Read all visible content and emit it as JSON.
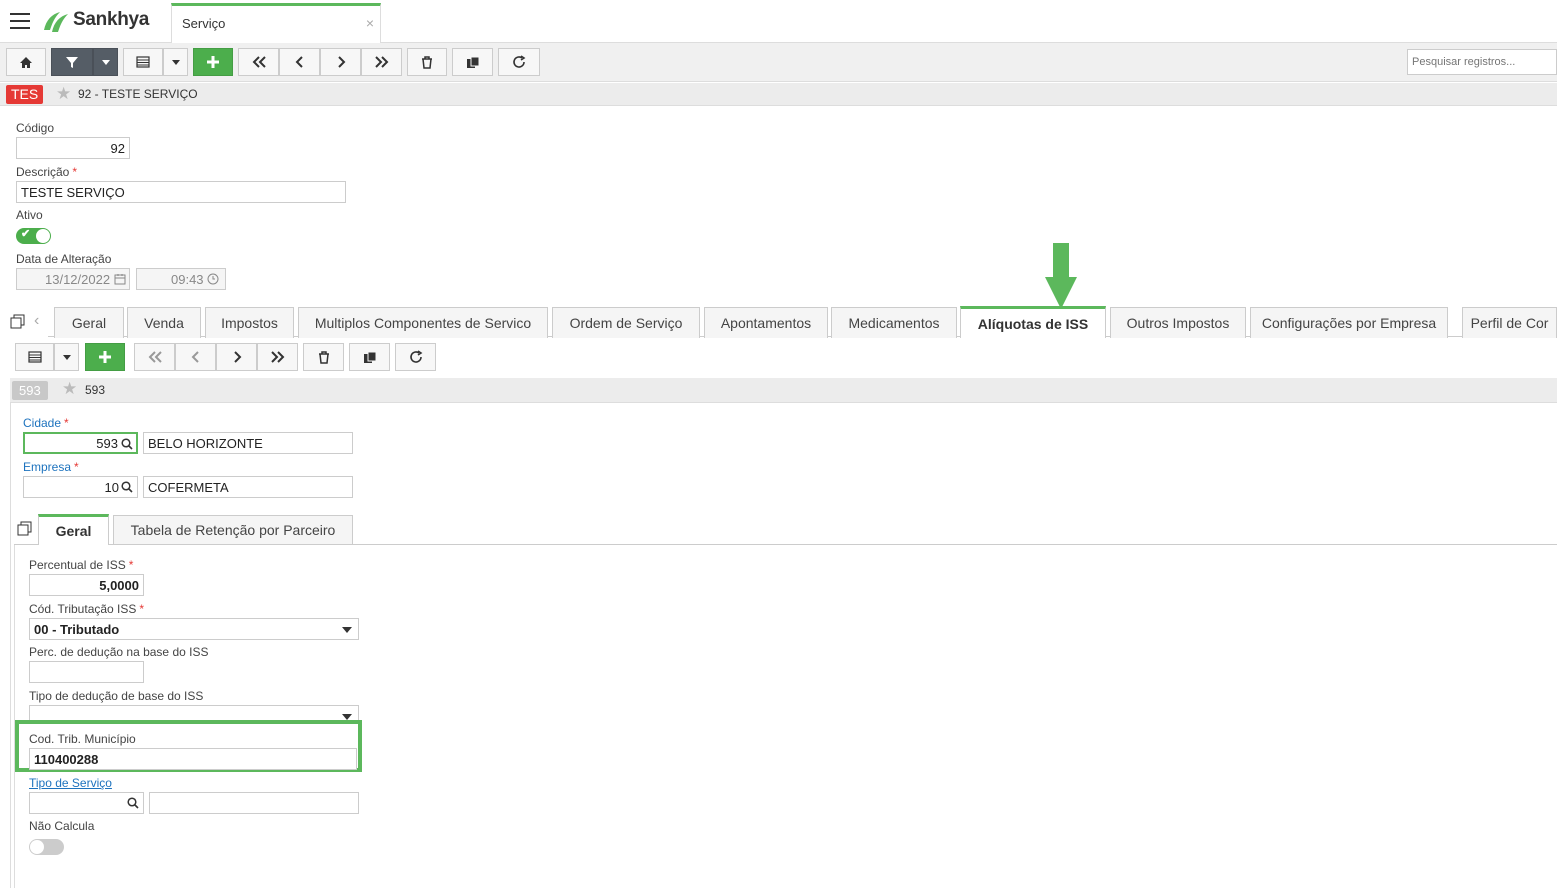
{
  "app": {
    "brand": "Sankhya",
    "tab_title": "Serviço",
    "tab_close": "×"
  },
  "toolbar": {
    "search_placeholder": "Pesquisar registros..."
  },
  "record": {
    "badge": "TES",
    "title": "92 - TESTE SERVIÇO"
  },
  "form": {
    "codigo_label": "Código",
    "codigo_value": "92",
    "descricao_label": "Descrição",
    "descricao_value": "TESTE SERVIÇO",
    "ativo_label": "Ativo",
    "ativo_on": true,
    "data_label": "Data de Alteração",
    "data_value": "13/12/2022",
    "hora_value": "09:43"
  },
  "tabs": [
    {
      "label": "Geral"
    },
    {
      "label": "Venda"
    },
    {
      "label": "Impostos"
    },
    {
      "label": "Multiplos Componentes de Servico"
    },
    {
      "label": "Ordem de Serviço"
    },
    {
      "label": "Apontamentos"
    },
    {
      "label": "Medicamentos"
    },
    {
      "label": "Alíquotas de ISS",
      "active": true
    },
    {
      "label": "Outros Impostos"
    },
    {
      "label": "Configurações por Empresa"
    },
    {
      "label": "Perfil de Cor"
    }
  ],
  "sub_record": {
    "badge": "593",
    "title": "593"
  },
  "iss": {
    "cidade_label": "Cidade",
    "cidade_code": "593",
    "cidade_name": "BELO HORIZONTE",
    "empresa_label": "Empresa",
    "empresa_code": "10",
    "empresa_name": "COFERMETA"
  },
  "inner_tabs": [
    {
      "label": "Geral",
      "active": true
    },
    {
      "label": "Tabela de Retenção por Parceiro"
    }
  ],
  "geral": {
    "percentual_label": "Percentual de ISS",
    "percentual_value": "5,0000",
    "cod_trib_label": "Cód. Tributação ISS",
    "cod_trib_value": "00 - Tributado",
    "perc_deducao_label": "Perc. de dedução na base do ISS",
    "perc_deducao_value": "",
    "tipo_deducao_label": "Tipo de dedução de base do ISS",
    "tipo_deducao_value": "",
    "cod_trib_mun_label": "Cod. Trib. Município",
    "cod_trib_mun_value": "110400288",
    "tipo_servico_label": "Tipo de Serviço",
    "tipo_servico_code": "",
    "tipo_servico_name": "",
    "nao_calcula_label": "Não Calcula",
    "nao_calcula_on": false
  },
  "colors": {
    "accent_green": "#5cb85c",
    "badge_red": "#e53935",
    "link_blue": "#1e73be"
  }
}
